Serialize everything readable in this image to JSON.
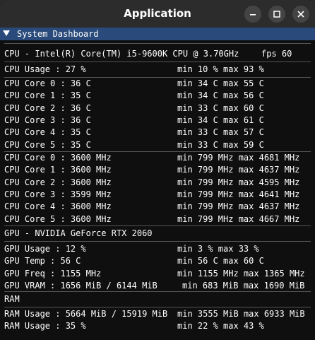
{
  "window": {
    "title": "Application"
  },
  "dashboard": {
    "header": "System Dashboard",
    "cpu_name": "CPU - Intel(R) Core(TM) i5-9600K CPU @ 3.70GHz",
    "fps": "fps 60",
    "cpu_usage": {
      "label": "CPU Usage : 27 %",
      "range": "min 10 % max 93 %"
    },
    "cpu_temps": [
      {
        "label": "CPU Core 0 : 36 C",
        "range": "min 34 C max 55 C"
      },
      {
        "label": "CPU Core 1 : 35 C",
        "range": "min 34 C max 56 C"
      },
      {
        "label": "CPU Core 2 : 36 C",
        "range": "min 33 C max 60 C"
      },
      {
        "label": "CPU Core 3 : 36 C",
        "range": "min 34 C max 61 C"
      },
      {
        "label": "CPU Core 4 : 35 C",
        "range": "min 33 C max 57 C"
      },
      {
        "label": "CPU Core 5 : 35 C",
        "range": "min 33 C max 59 C"
      }
    ],
    "cpu_freqs": [
      {
        "label": "CPU Core 0 : 3600 MHz",
        "range": "min 799 MHz max 4681 MHz"
      },
      {
        "label": "CPU Core 1 : 3600 MHz",
        "range": "min 799 MHz max 4637 MHz"
      },
      {
        "label": "CPU Core 2 : 3600 MHz",
        "range": "min 799 MHz max 4595 MHz"
      },
      {
        "label": "CPU Core 3 : 3599 MHz",
        "range": "min 799 MHz max 4641 MHz"
      },
      {
        "label": "CPU Core 4 : 3600 MHz",
        "range": "min 799 MHz max 4637 MHz"
      },
      {
        "label": "CPU Core 5 : 3600 MHz",
        "range": "min 799 MHz max 4667 MHz"
      }
    ],
    "gpu_name": "GPU - NVIDIA GeForce RTX 2060",
    "gpu_stats": [
      {
        "label": "GPU Usage : 12 %",
        "range": "min 3 % max 33 %"
      },
      {
        "label": "GPU Temp : 56 C",
        "range": "min 56 C max 60 C"
      },
      {
        "label": "GPU Freq : 1155 MHz",
        "range": "min 1155 MHz max 1365 MHz"
      },
      {
        "label": "GPU VRAM : 1656 MiB / 6144 MiB",
        "range": "min 683 MiB max 1690 MiB"
      }
    ],
    "ram_title": "RAM",
    "ram_stats": [
      {
        "label": "RAM Usage : 5664 MiB / 15919 MiB",
        "range": "min 3555 MiB max 6933 MiB"
      },
      {
        "label": "RAM Usage : 35 %",
        "range": "min 22 % max 43 %"
      }
    ]
  },
  "colors": {
    "header_bg": "#294a7a",
    "separator": "#555555",
    "text": "#ffffff"
  }
}
